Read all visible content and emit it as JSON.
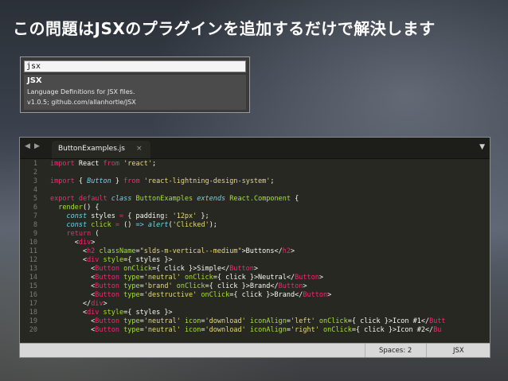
{
  "headline": "この問題はJSXのプラグインを追加するだけで解決します",
  "package_panel": {
    "query": "jsx",
    "result": {
      "name": "JSX",
      "description": "Language Definitions for JSX files.",
      "meta": "v1.0.5; github.com/allanhortle/JSX"
    }
  },
  "editor": {
    "nav_back_icon": "◀",
    "nav_forward_icon": "▶",
    "tab": {
      "label": "ButtonExamples.js",
      "close": "×"
    },
    "menu_icon": "▼",
    "line_numbers": [
      "1",
      "2",
      "3",
      "4",
      "5",
      "6",
      "7",
      "8",
      "9",
      "10",
      "11",
      "12",
      "13",
      "14",
      "15",
      "16",
      "17",
      "18",
      "19",
      "20"
    ],
    "status": {
      "spaces": "Spaces: 2",
      "syntax": "JSX"
    }
  },
  "colors": {
    "keyword": "#f92672",
    "string": "#e6db74",
    "component": "#66d9ef",
    "function": "#a6e22e",
    "editor_bg": "#272822"
  }
}
